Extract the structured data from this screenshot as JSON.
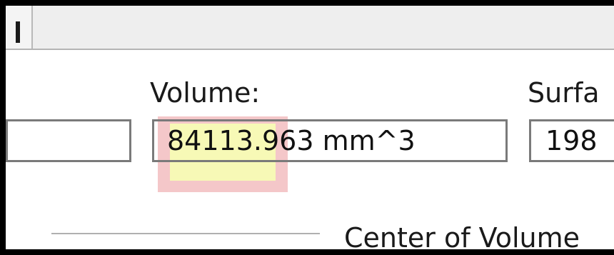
{
  "volume": {
    "label": "Volume:",
    "value": "84113.963 mm^3",
    "highlight_color": "#f7f9b6"
  },
  "surface": {
    "label": "Surfa",
    "value": "198"
  },
  "center_of_volume": {
    "label": "Center of Volume"
  }
}
